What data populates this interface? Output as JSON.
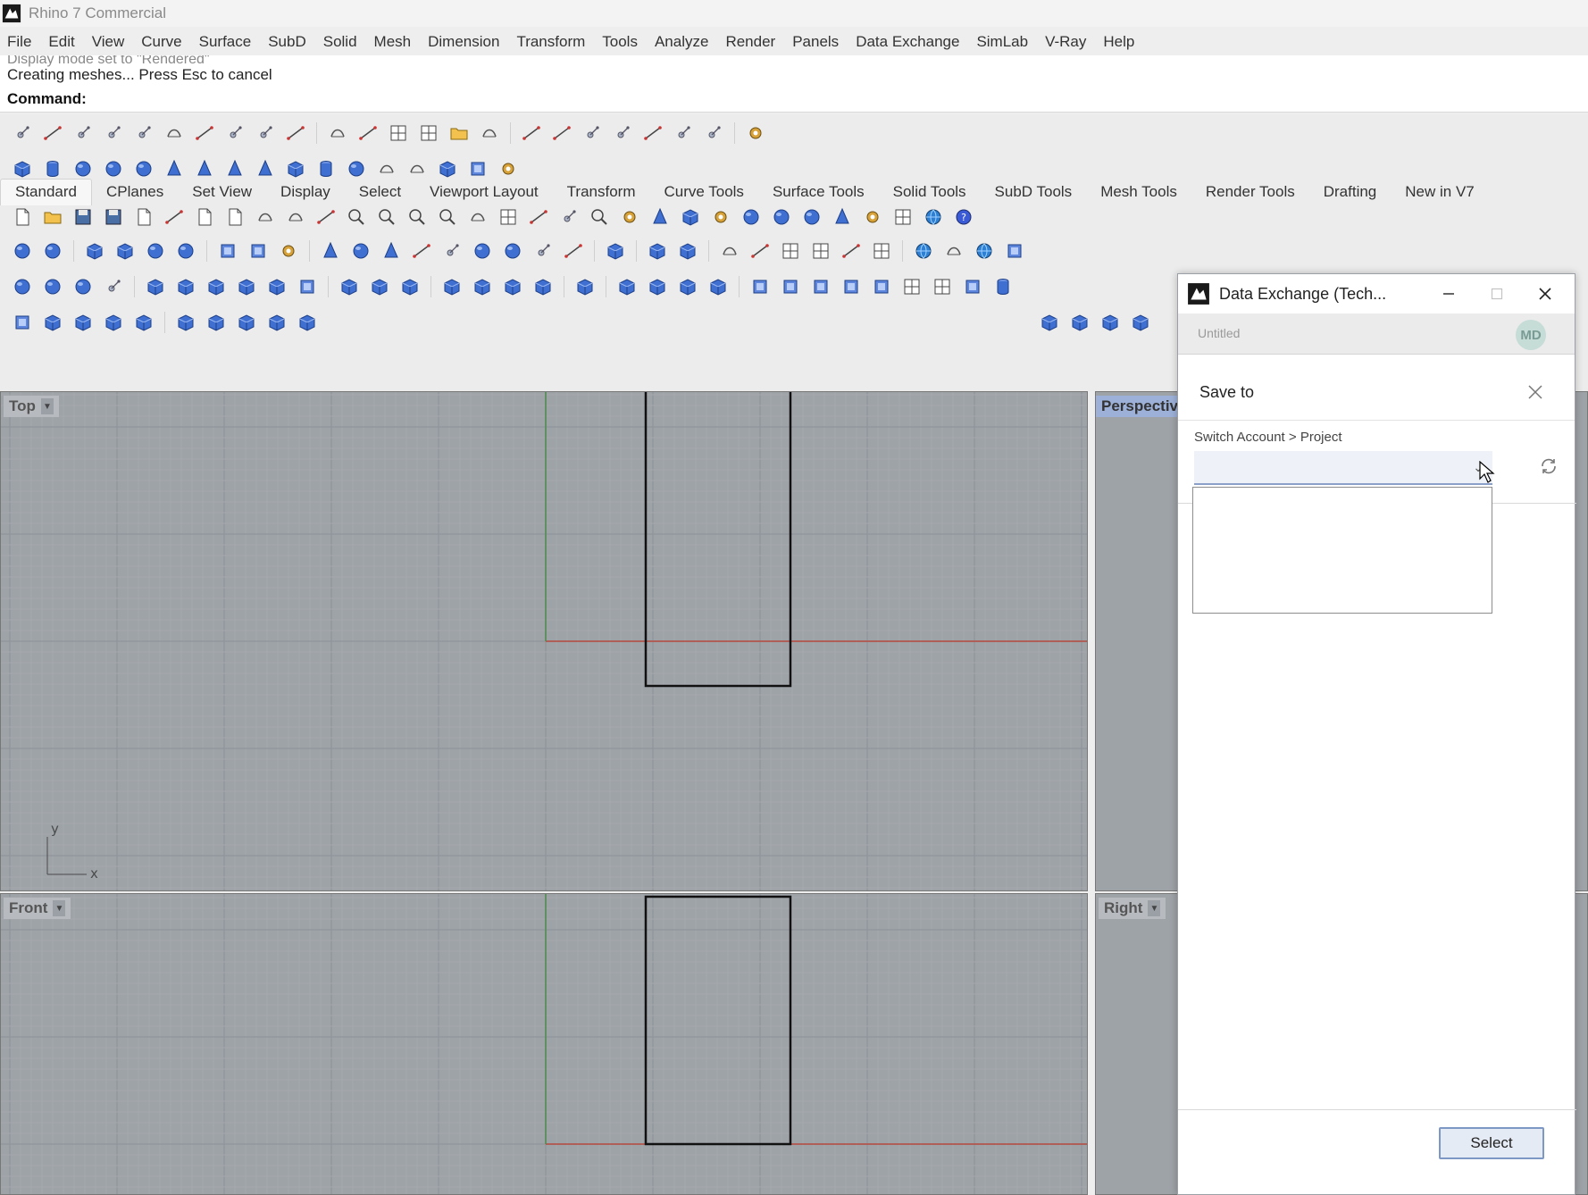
{
  "window": {
    "title": "Rhino 7 Commercial"
  },
  "menu": [
    "File",
    "Edit",
    "View",
    "Curve",
    "Surface",
    "SubD",
    "Solid",
    "Mesh",
    "Dimension",
    "Transform",
    "Tools",
    "Analyze",
    "Render",
    "Panels",
    "Data Exchange",
    "SimLab",
    "V-Ray",
    "Help"
  ],
  "command": {
    "history_ghost": "Display mode set to \"Rendered\"",
    "history_line": "Creating meshes... Press Esc to cancel",
    "label": "Command:",
    "value": ""
  },
  "tabs": [
    "Standard",
    "CPlanes",
    "Set View",
    "Display",
    "Select",
    "Viewport Layout",
    "Transform",
    "Curve Tools",
    "Surface Tools",
    "Solid Tools",
    "SubD Tools",
    "Mesh Tools",
    "Render Tools",
    "Drafting",
    "New in V7"
  ],
  "viewports": {
    "top": "Top",
    "perspective": "Perspective",
    "front": "Front",
    "right": "Right",
    "axis_y": "y",
    "axis_x": "x"
  },
  "dialog": {
    "title": "Data Exchange (Tech...",
    "document": "Untitled",
    "avatar": "MD",
    "save_to": "Save to",
    "switch_label": "Switch Account > Project",
    "project_value": "",
    "select_button": "Select"
  },
  "colors": {
    "viewport_bg": "#9ea3a8",
    "grid_minor": "#a7acb1",
    "grid_major": "#8f959b",
    "axis_x": "#b84a3e",
    "axis_y": "#4d8a4d",
    "active_label": "#9db0d8",
    "accent": "#7e98c6"
  }
}
